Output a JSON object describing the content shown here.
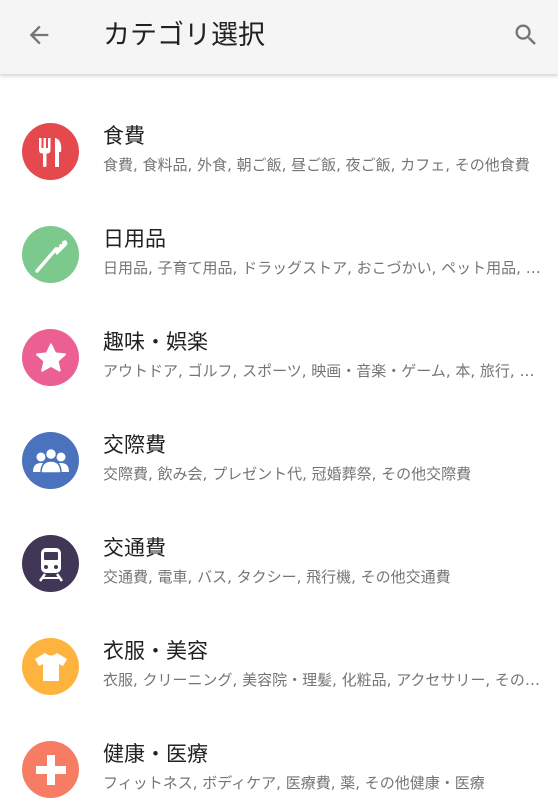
{
  "header": {
    "title": "カテゴリ選択",
    "back_icon": "arrow-back-icon",
    "search_icon": "search-icon"
  },
  "categories": [
    {
      "name": "食費",
      "sub": "食費, 食料品, 外食, 朝ご飯, 昼ご飯, 夜ご飯, カフェ, その他食費",
      "icon": "fork-knife-icon",
      "color": "#e5484d"
    },
    {
      "name": "日用品",
      "sub": "日用品, 子育て用品, ドラッグストア, おこづかい, ペット用品, その他日用品",
      "icon": "toothbrush-icon",
      "color": "#7cc98e"
    },
    {
      "name": "趣味・娯楽",
      "sub": "アウトドア, ゴルフ, スポーツ, 映画・音楽・ゲーム, 本, 旅行, その他趣味・娯楽",
      "icon": "star-icon",
      "color": "#ec5f93"
    },
    {
      "name": "交際費",
      "sub": "交際費, 飲み会, プレゼント代, 冠婚葬祭, その他交際費",
      "icon": "people-icon",
      "color": "#4a72bd"
    },
    {
      "name": "交通費",
      "sub": "交通費, 電車, バス, タクシー, 飛行機, その他交通費",
      "icon": "train-icon",
      "color": "#403656"
    },
    {
      "name": "衣服・美容",
      "sub": "衣服, クリーニング, 美容院・理髪, 化粧品, アクセサリー, その他衣服・美容",
      "icon": "tshirt-icon",
      "color": "#ffb33f"
    },
    {
      "name": "健康・医療",
      "sub": "フィットネス, ボディケア, 医療費, 薬, その他健康・医療",
      "icon": "medical-cross-icon",
      "color": "#f67c63"
    }
  ]
}
